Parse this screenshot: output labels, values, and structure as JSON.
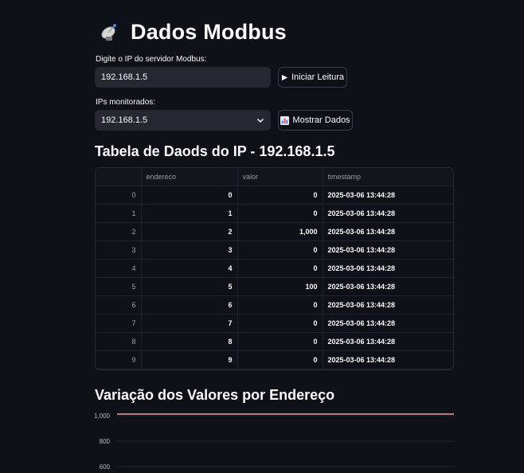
{
  "page": {
    "title": "Dados Modbus",
    "title_icon": "satellite-dish-icon"
  },
  "ip_form": {
    "label": "Digite o IP do servidor Modbus:",
    "value": "192.168.1.5",
    "start_button": "Iniciar Leitura",
    "start_icon": "play-icon"
  },
  "monitor": {
    "label": "IPs monitorados:",
    "selected": "192.168.1.5",
    "show_button": "Mostrar Dados",
    "show_icon": "bar-chart-icon"
  },
  "table": {
    "title": "Tabela de Daods do IP - 192.168.1.5",
    "columns": [
      "",
      "endereco",
      "valor",
      "timestamp"
    ],
    "rows": [
      [
        "0",
        "0",
        "0",
        "2025-03-06 13:44:28"
      ],
      [
        "1",
        "1",
        "0",
        "2025-03-06 13:44:28"
      ],
      [
        "2",
        "2",
        "1,000",
        "2025-03-06 13:44:28"
      ],
      [
        "3",
        "3",
        "0",
        "2025-03-06 13:44:28"
      ],
      [
        "4",
        "4",
        "0",
        "2025-03-06 13:44:28"
      ],
      [
        "5",
        "5",
        "100",
        "2025-03-06 13:44:28"
      ],
      [
        "6",
        "6",
        "0",
        "2025-03-06 13:44:28"
      ],
      [
        "7",
        "7",
        "0",
        "2025-03-06 13:44:28"
      ],
      [
        "8",
        "8",
        "0",
        "2025-03-06 13:44:28"
      ],
      [
        "9",
        "9",
        "0",
        "2025-03-06 13:44:28"
      ]
    ]
  },
  "chart_section": {
    "title": "Variação dos Valores por Endereço"
  },
  "chart_data": {
    "type": "line",
    "title": "Variação dos Valores por Endereço",
    "ytick_labels": [
      "1,000",
      "800",
      "600"
    ],
    "yticks": [
      1000,
      800,
      600
    ],
    "visible_line": {
      "y": 1000,
      "color": "#e8a3a3"
    },
    "grid": true
  }
}
